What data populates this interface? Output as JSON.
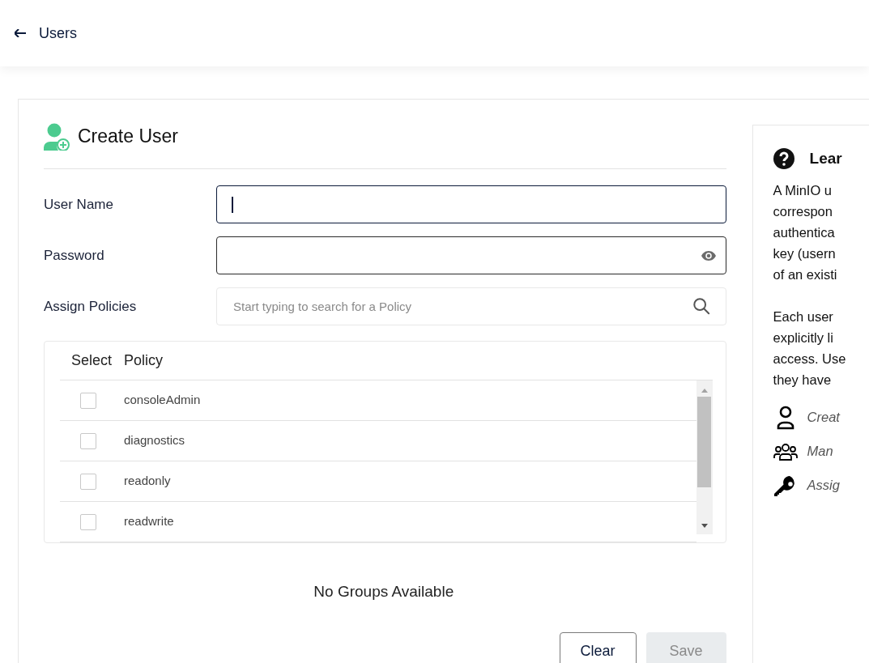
{
  "header": {
    "back_label": "Users"
  },
  "form": {
    "title": "Create User",
    "fields": [
      {
        "kind": "text",
        "label": "User Name",
        "focused": true
      },
      {
        "kind": "password",
        "label": "Password",
        "focused": false
      },
      {
        "kind": "search",
        "label": "Assign Policies",
        "placeholder": "Start typing to search for a Policy",
        "focused": false
      }
    ],
    "policy_table": {
      "columns": [
        "Select",
        "Policy"
      ],
      "rows": [
        {
          "name": "consoleAdmin",
          "checked": false
        },
        {
          "name": "diagnostics",
          "checked": false
        },
        {
          "name": "readonly",
          "checked": false
        },
        {
          "name": "readwrite",
          "checked": false
        }
      ]
    },
    "groups_message": "No Groups Available",
    "buttons": [
      {
        "label": "Clear",
        "disabled": false
      },
      {
        "label": "Save",
        "disabled": true
      }
    ]
  },
  "help_panel": {
    "title": "Lear",
    "paragraphs": [
      [
        "A MinIO u",
        "correspon",
        "authentica",
        "key (usern",
        "of an existi"
      ],
      [
        "Each user",
        "explicitly li",
        "access. Use",
        "they have"
      ]
    ],
    "links": [
      {
        "kind": "user",
        "label": "Creat"
      },
      {
        "kind": "users",
        "label": "Man"
      },
      {
        "kind": "key",
        "label": "Assig"
      }
    ]
  }
}
